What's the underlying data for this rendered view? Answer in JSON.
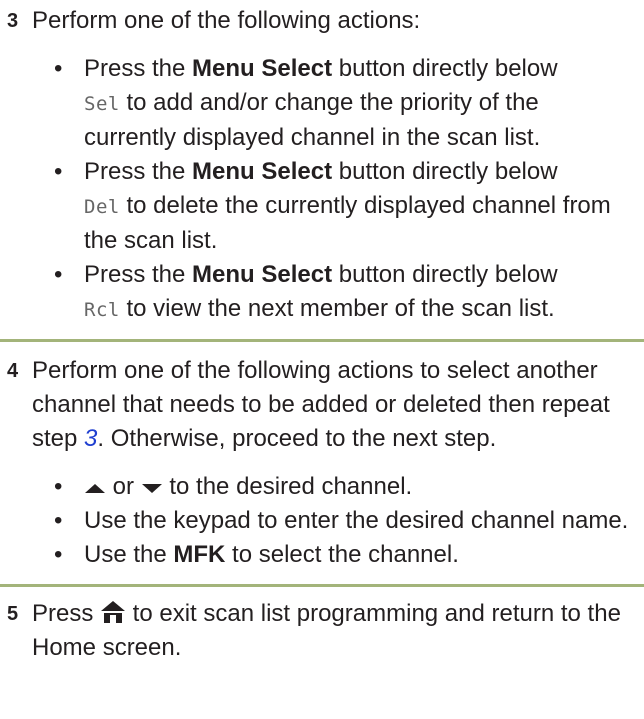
{
  "step3": {
    "number": "3",
    "intro": "Perform one of the following actions:",
    "bullets": [
      {
        "pre": "Press the ",
        "bold": "Menu Select",
        "mid": " button directly below",
        "code": "Sel",
        "post": " to add and/or change the priority of the currently displayed channel in the scan list."
      },
      {
        "pre": "Press the ",
        "bold": "Menu Select",
        "mid": " button directly below",
        "code": "Del",
        "post": " to delete the currently displayed channel from the scan list."
      },
      {
        "pre": "Press the ",
        "bold": "Menu Select",
        "mid": " button directly below",
        "code": "Rcl",
        "post": " to view the next member of the scan list."
      }
    ]
  },
  "step4": {
    "number": "4",
    "intro_pre": "Perform one of the following actions to select another channel that needs to be added or deleted then repeat step ",
    "intro_link": "3",
    "intro_post": ". Otherwise, proceed to the next step.",
    "bullets": {
      "b1_or": " or ",
      "b1_post": " to the desired channel.",
      "b2": "Use the keypad to enter the desired channel name.",
      "b3_pre": "Use the ",
      "b3_bold": "MFK",
      "b3_post": " to select the channel."
    },
    "icons": {
      "up": "arrow-up-icon",
      "down": "arrow-down-icon"
    }
  },
  "step5": {
    "number": "5",
    "pre": "Press ",
    "post": " to exit scan list programming and return to the Home screen.",
    "icon": "home-icon"
  },
  "bullet_char": "•",
  "colors": {
    "divider": "#a3b47a",
    "link": "#1f3fd0",
    "code": "#666666"
  }
}
